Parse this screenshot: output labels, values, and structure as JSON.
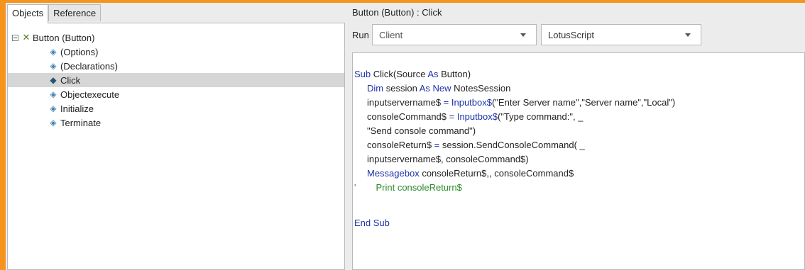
{
  "tabs": [
    "Objects",
    "Reference"
  ],
  "tree": {
    "root": "Button (Button)",
    "events": [
      "(Options)",
      "(Declarations)",
      "Click",
      "Objectexecute",
      "Initialize",
      "Terminate"
    ],
    "selected_index": 2
  },
  "header": {
    "title": "Button (Button) : Click"
  },
  "run": {
    "label": "Run",
    "client_value": "Client",
    "language_value": "LotusScript"
  },
  "code": {
    "l1_kw": "Sub",
    "l1_rest": " Click(Source ",
    "l1_as": "As",
    "l1_end": " Button)",
    "l2_dim": "Dim",
    "l2_mid": " session ",
    "l2_asnew": "As New",
    "l2_end": " NotesSession",
    "l3_a": "inputservername$ ",
    "l3_eq": "= Inputbox$",
    "l3_b": "(\"Enter Server name\",\"Server name\",\"Local\")",
    "l4_a": "consoleCommand$ ",
    "l4_eq": "= Inputbox$",
    "l4_b": "(\"Type command:\", _",
    "l5": "\"Send console command\")",
    "l6_a": "consoleReturn$ ",
    "l6_eq": "=",
    "l6_b": " session.SendConsoleCommand( _",
    "l7": "inputservername$, consoleCommand$)",
    "l8_kw": "Messagebox",
    "l8_rest": " consoleReturn$,, consoleCommand$",
    "l9_tick": "'",
    "l9_comment": "Print consoleReturn$",
    "l11": "End Sub"
  },
  "colors": {
    "border": "#f7941d",
    "keyword": "#1d33a8",
    "comment": "#2a8a2a"
  }
}
